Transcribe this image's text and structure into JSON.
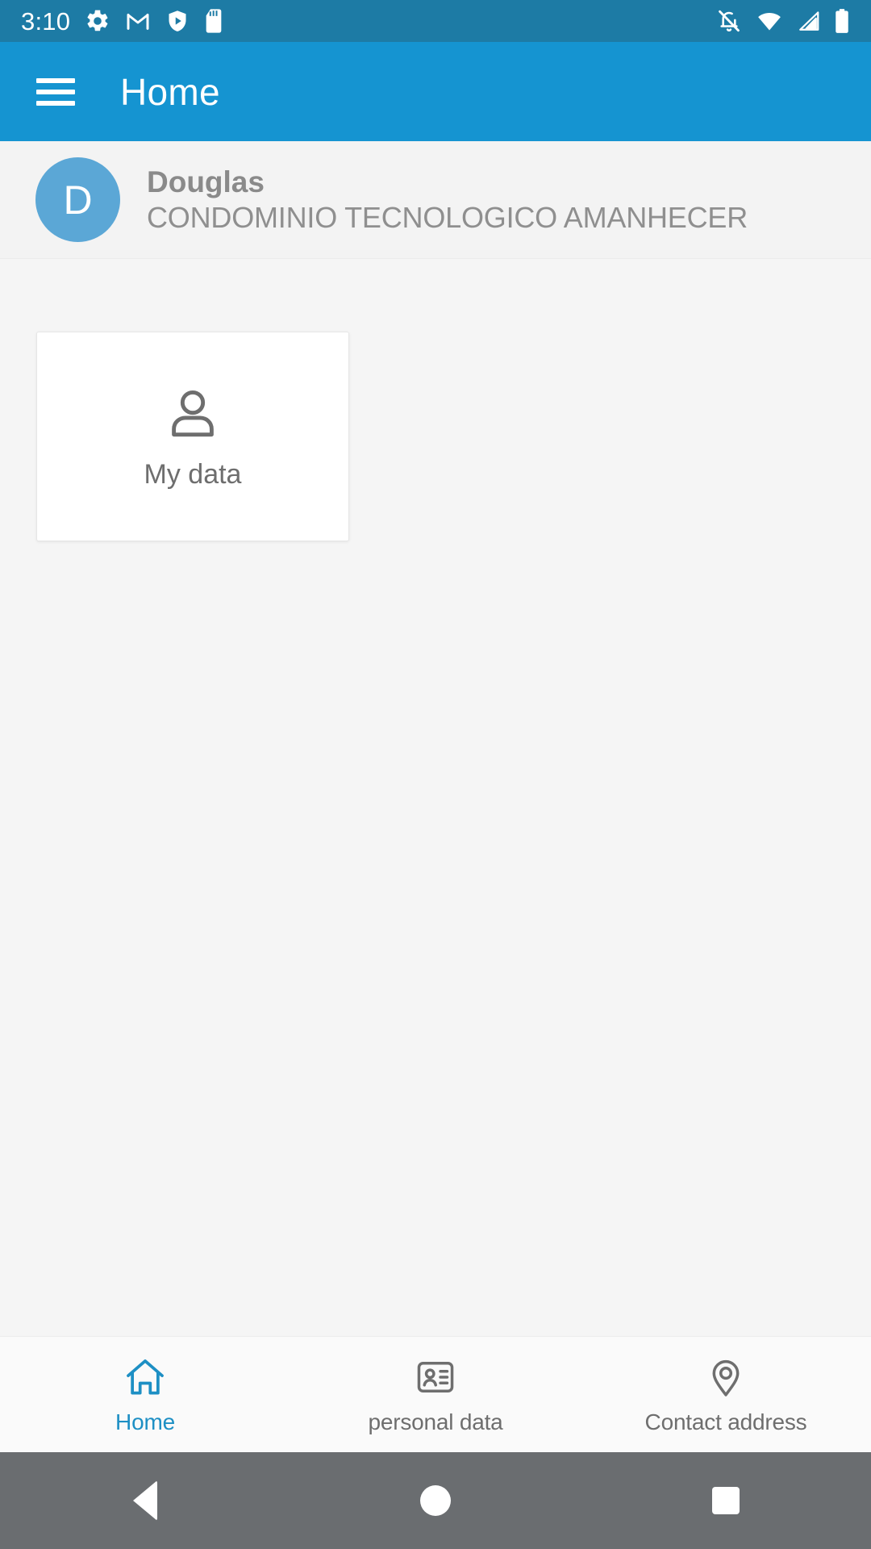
{
  "status_bar": {
    "time": "3:10",
    "left_icons": [
      "gear-icon",
      "gmail-icon",
      "shield-play-icon",
      "sd-card-icon"
    ],
    "right_icons": [
      "notifications-off-icon",
      "wifi-icon",
      "cellular-signal-icon",
      "battery-icon"
    ],
    "background_color": "#1d7ba5"
  },
  "app_bar": {
    "menu_icon": "hamburger-menu-icon",
    "title": "Home",
    "background_color": "#1594d1"
  },
  "profile": {
    "avatar_initial": "D",
    "avatar_color": "#5ba7d6",
    "name": "Douglas",
    "organization": "CONDOMINIO TECNOLOGICO AMANHECER"
  },
  "main": {
    "tiles": [
      {
        "icon": "person-outline-icon",
        "label": "My data"
      }
    ],
    "background_color": "#f5f5f5"
  },
  "bottom_nav": {
    "active_color": "#1d8fc4",
    "inactive_color": "#6e6e6e",
    "items": [
      {
        "icon": "home-icon",
        "label": "Home",
        "active": true
      },
      {
        "icon": "id-card-icon",
        "label": "personal data",
        "active": false
      },
      {
        "icon": "location-pin-icon",
        "label": "Contact address",
        "active": false
      }
    ]
  },
  "android_nav": {
    "buttons": [
      "back-button",
      "home-button",
      "recents-button"
    ],
    "background_color": "#6a6d70"
  }
}
